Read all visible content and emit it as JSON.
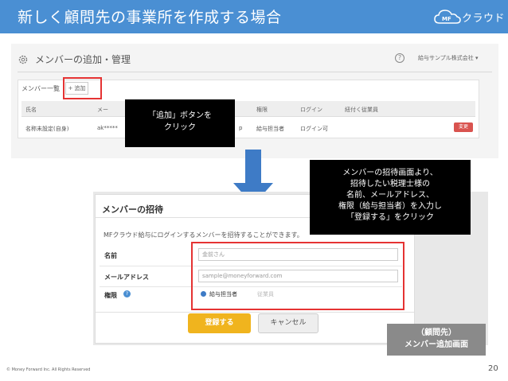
{
  "header": {
    "title": "新しく顧問先の事業所を作成する場合",
    "logo_mark": "MF",
    "logo_text": "クラウド"
  },
  "settings_screen": {
    "title": "メンバーの追加・管理",
    "help": "?",
    "company": "給与サンプル株式会社 ▾",
    "list_label": "メンバー一覧",
    "add_button": "+ 追加",
    "columns": [
      "氏名",
      "メー",
      "権限",
      "ログイン",
      "紐付く従業員"
    ],
    "row": {
      "name": "名称未設定(自身)",
      "email": "ak*****",
      "email_tail": "p",
      "role": "給与担当者",
      "login": "ログイン可",
      "change_button": "変更"
    }
  },
  "callout_add": {
    "line1": "「追加」ボタンを",
    "line2": "クリック"
  },
  "callout_invite": {
    "line1": "メンバーの招待画面より、",
    "line2": "招待したい税理士様の",
    "line3": "名前、メールアドレス、",
    "line4": "権限（給与担当者）を入力し",
    "line5": "「登録する」をクリック"
  },
  "invite_dialog": {
    "title": "メンバーの招待",
    "description": "MFクラウド給与にログインするメンバーを招待することができます。",
    "name_label": "名前",
    "name_placeholder": "金前さん",
    "email_label": "メールアドレス",
    "email_placeholder": "sample@moneyforward.com",
    "role_label": "権限",
    "role_info": "?",
    "role_option_selected": "給与担当者",
    "role_option_other": "従業員",
    "register_button": "登録する",
    "cancel_button": "キャンセル"
  },
  "caption": {
    "line1": "（顧問先）",
    "line2": "メンバー追加画面"
  },
  "footer": {
    "copyright": "© Money Forward Inc. All Rights Reserved",
    "page": "20"
  },
  "colors": {
    "header": "#4a8fd3",
    "highlight": "#e53333",
    "arrow": "#3e7bc6",
    "register": "#f0b41e"
  }
}
